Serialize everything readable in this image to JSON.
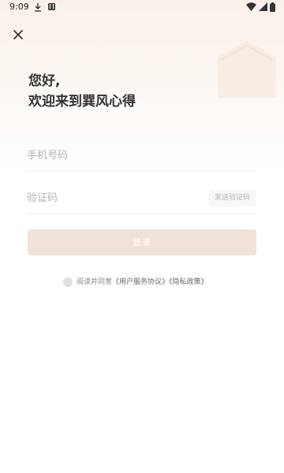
{
  "status_bar": {
    "time": "9:09",
    "icons": [
      "download-icon",
      "app-notification-icon",
      "wifi-icon",
      "signal-icon",
      "battery-icon"
    ]
  },
  "header": {
    "close_icon": "close-icon",
    "greeting_line1": "您好,",
    "greeting_line2": "欢迎来到巽风心得"
  },
  "form": {
    "phone": {
      "value": "",
      "placeholder": "手机号码"
    },
    "code": {
      "value": "",
      "placeholder": "验证码",
      "send_label": "发送验证码"
    },
    "login_label": "登录"
  },
  "agreement": {
    "checked": false,
    "prefix": "阅读并同意",
    "terms_link": "《用户服务协议》",
    "privacy_link": "《隐私政策》"
  },
  "colors": {
    "background": "#ffffff",
    "warm_header": "#f9f0e8",
    "login_button_disabled": "#f0e2d7",
    "primary_text": "#333333",
    "placeholder_text": "#b3b3b3",
    "divider": "#ededed"
  }
}
